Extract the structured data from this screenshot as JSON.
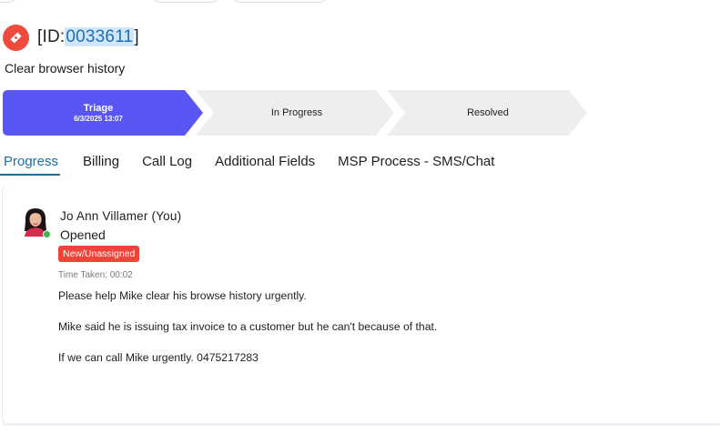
{
  "ticket": {
    "id_prefix": "[ID:",
    "id_number": "0033611",
    "id_suffix": "]",
    "subject": "Clear browser history",
    "icon": "ticket-icon"
  },
  "stepper": {
    "steps": [
      {
        "label": "Triage",
        "date": "6/3/2025 13:07",
        "state": "active"
      },
      {
        "label": "In Progress",
        "state": "pending"
      },
      {
        "label": "Resolved",
        "state": "pending"
      }
    ],
    "active_color": "#5a55f5",
    "pending_color": "#eeeeee"
  },
  "tabs": [
    {
      "label": "Progress",
      "active": true
    },
    {
      "label": "Billing",
      "active": false
    },
    {
      "label": "Call Log",
      "active": false
    },
    {
      "label": "Additional Fields",
      "active": false
    },
    {
      "label": "MSP Process - SMS/Chat",
      "active": false
    }
  ],
  "progress": {
    "entry": {
      "author": "Jo Ann Villamer (You)",
      "action": "Opened",
      "status_badge": "New/Unassigned",
      "status_color": "#f0443a",
      "time_taken": "Time Taken: 00:02",
      "messages": [
        "Please help Mike clear his browse history urgently.",
        "Mike said he is issuing tax invoice to a customer but he can't because of that.",
        "If we can call Mike urgently. 0475217283"
      ]
    }
  }
}
